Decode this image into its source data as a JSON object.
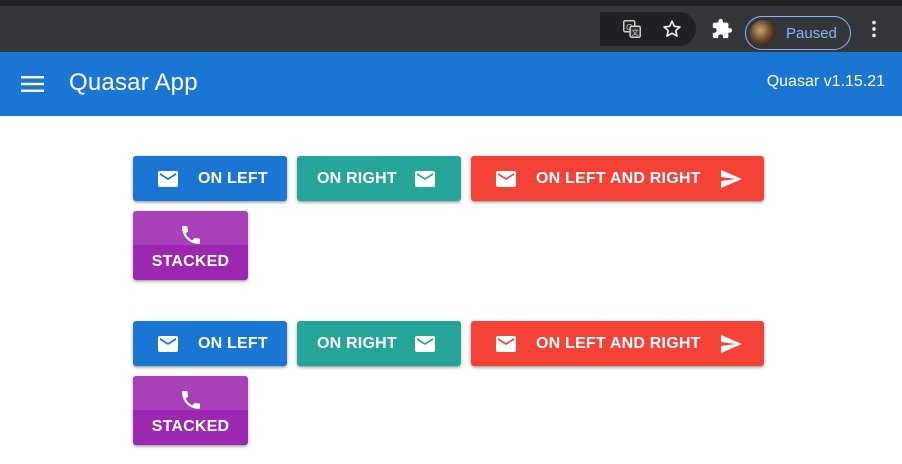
{
  "browser": {
    "profile_label": "Paused",
    "icons": [
      "translate-icon",
      "bookmark-star-icon",
      "extensions-icon",
      "more-vert-icon"
    ]
  },
  "header": {
    "title": "Quasar App",
    "version": "Quasar v1.15.21"
  },
  "groups": [
    {
      "on_left_label": "ON LEFT",
      "on_right_label": "ON RIGHT",
      "on_left_and_right_label": "ON LEFT AND RIGHT",
      "stacked_label": "STACKED"
    },
    {
      "on_left_label": "ON LEFT",
      "on_right_label": "ON RIGHT",
      "on_left_and_right_label": "ON LEFT AND RIGHT",
      "stacked_label": "STACKED"
    }
  ],
  "colors": {
    "primary": "#1976d2",
    "teal": "#26a69a",
    "red": "#f44336",
    "purple": "#9c27b0"
  }
}
